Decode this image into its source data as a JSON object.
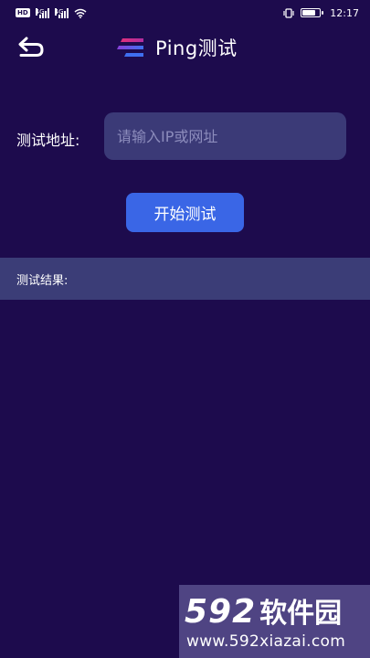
{
  "status_bar": {
    "hd": "HD",
    "net1": "4G",
    "net2": "4G",
    "time": "12:17",
    "battery_level": 0.85
  },
  "header": {
    "title": "Ping测试",
    "back_icon": "back-arrow-icon",
    "logo_icon": "app-logo-icon"
  },
  "form": {
    "address_label": "测试地址:",
    "address_placeholder": "请输入IP或网址",
    "address_value": "",
    "start_button": "开始测试"
  },
  "result": {
    "label": "测试结果:",
    "content": ""
  },
  "watermark": {
    "number": "592",
    "brand": "软件园",
    "url": "www.592xiazai.com"
  },
  "colors": {
    "background": "#1d0b4d",
    "input_bg": "#3b3a77",
    "button": "#3a66e6",
    "result_bar": "#3b3d77"
  }
}
